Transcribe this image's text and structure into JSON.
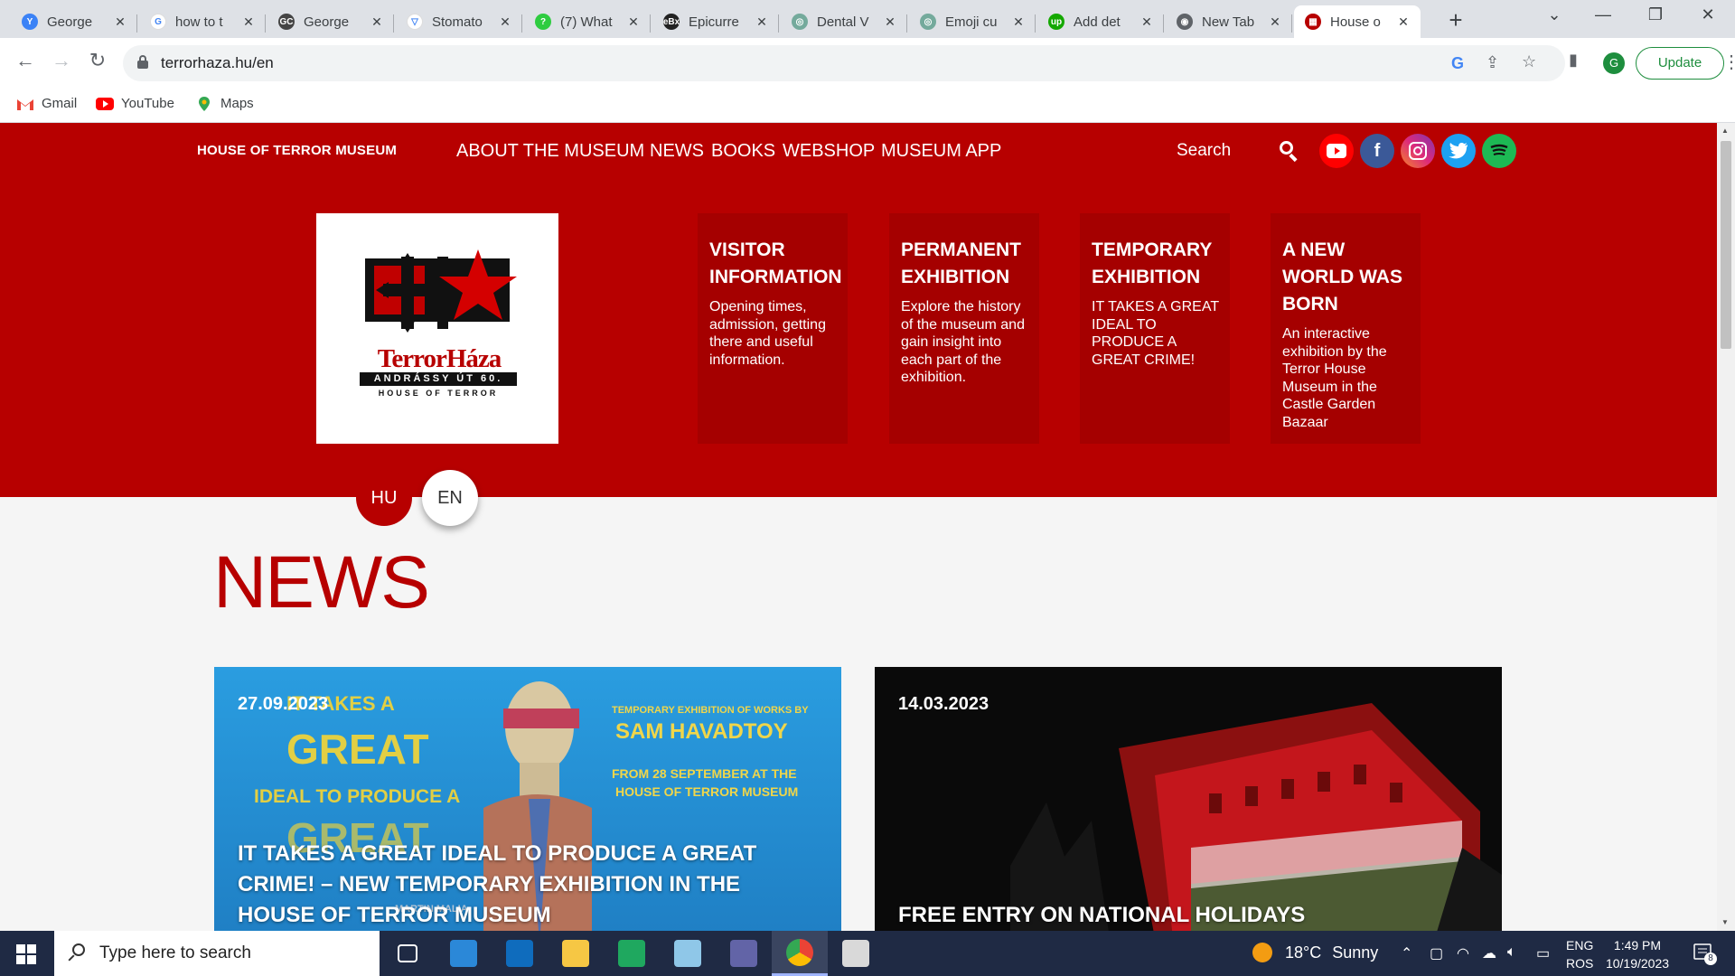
{
  "browser": {
    "tabs": [
      {
        "title": "George",
        "favicon_color": "#3b82f6",
        "favicon_glyph": "Y",
        "icon": "testing-icon"
      },
      {
        "title": "how to t",
        "favicon_color": "#ffffff",
        "favicon_glyph": "G",
        "icon": "google-icon"
      },
      {
        "title": "George",
        "favicon_color": "#444444",
        "favicon_glyph": "GC",
        "icon": "gc-icon"
      },
      {
        "title": "Stomato",
        "favicon_color": "#ffffff",
        "favicon_glyph": "▽",
        "icon": "vector-icon"
      },
      {
        "title": "(7) What",
        "favicon_color": "#2ecc40",
        "favicon_glyph": "?",
        "icon": "quora-icon"
      },
      {
        "title": "Epicurre",
        "favicon_color": "#222222",
        "favicon_glyph": "eBx",
        "icon": "ebx-icon"
      },
      {
        "title": "Dental V",
        "favicon_color": "#74aa9c",
        "favicon_glyph": "◎",
        "icon": "chatgpt-icon"
      },
      {
        "title": "Emoji cu",
        "favicon_color": "#74aa9c",
        "favicon_glyph": "◎",
        "icon": "chatgpt-icon"
      },
      {
        "title": "Add det",
        "favicon_color": "#14a800",
        "favicon_glyph": "up",
        "icon": "upwork-icon"
      },
      {
        "title": "New Tab",
        "favicon_color": "#5f6368",
        "favicon_glyph": "◉",
        "icon": "chrome-icon"
      },
      {
        "title": "House o",
        "favicon_color": "#b70000",
        "favicon_glyph": "▦",
        "icon": "terrorhaza-icon",
        "active": true
      }
    ],
    "url": "terrorhaza.hu/en",
    "profile_initial": "G",
    "update_label": "Update",
    "bookmarks": [
      {
        "label": "Gmail",
        "icon": "gmail-icon",
        "color": "#ea4335"
      },
      {
        "label": "YouTube",
        "icon": "youtube-icon",
        "color": "#ff0000"
      },
      {
        "label": "Maps",
        "icon": "maps-icon",
        "color": "#34a853"
      }
    ]
  },
  "site": {
    "brand": "HOUSE OF TERROR MUSEUM",
    "nav": [
      "ABOUT THE MUSEUM",
      "NEWS",
      "BOOKS",
      "WEBSHOP",
      "MUSEUM APP"
    ],
    "search_label": "Search",
    "social": [
      {
        "name": "youtube",
        "color": "#ff0000",
        "glyph": "▶"
      },
      {
        "name": "facebook",
        "color": "#3b5998",
        "glyph": "f"
      },
      {
        "name": "instagram",
        "color": "#c13584",
        "glyph": "◎"
      },
      {
        "name": "twitter",
        "color": "#1da1f2",
        "glyph": "✦"
      },
      {
        "name": "spotify",
        "color": "#1db954",
        "glyph": "≋"
      }
    ],
    "logo": {
      "title": "TerrorHáza",
      "address": "ANDRÁSSY ÚT 60.",
      "subtitle": "HOUSE OF TERROR"
    },
    "cards": [
      {
        "title": "VISITOR INFORMATION",
        "text": "Opening times, admission, getting there and useful information."
      },
      {
        "title": "PERMANENT EXHIBITION",
        "text": "Explore the history of the museum and gain insight into each part of the exhibition."
      },
      {
        "title": "TEMPORARY EXHIBITION",
        "text": "IT TAKES A GREAT IDEAL TO PRODUCE A GREAT CRIME!"
      },
      {
        "title": "A NEW WORLD WAS BORN",
        "text": "An interactive exhibition by the Terror House Museum in the Castle Garden Bazaar"
      }
    ],
    "languages": [
      "HU",
      "EN"
    ],
    "active_language": "EN",
    "news_heading": "NEWS",
    "news": [
      {
        "date": "27.09.2023",
        "title": "IT TAKES A GREAT IDEAL TO PRODUCE A GREAT CRIME! – NEW TEMPORARY EXHIBITION IN THE HOUSE OF TERROR MUSEUM",
        "poster": {
          "line1": "IT TAKES A",
          "line2": "GREAT",
          "line3": "IDEAL TO PRODUCE A",
          "line4": "GREAT",
          "right1": "TEMPORARY EXHIBITION OF WORKS BY",
          "right2": "SAM HAVADTOY",
          "right3": "FROM 28 SEPTEMBER AT THE",
          "right4": "HOUSE OF TERROR MUSEUM",
          "bottom": "MARTIN MALIA"
        }
      },
      {
        "date": "14.03.2023",
        "title": "FREE ENTRY ON NATIONAL HOLIDAYS"
      }
    ]
  },
  "taskbar": {
    "search_placeholder": "Type here to search",
    "apps": [
      {
        "name": "task-view-icon",
        "color": "#ffffff"
      },
      {
        "name": "microsoft-store-icon",
        "color": "#2b88d8"
      },
      {
        "name": "mail-icon",
        "color": "#0f6cbd"
      },
      {
        "name": "file-explorer-icon",
        "color": "#f6c744"
      },
      {
        "name": "edge-icon",
        "color": "#1fa85f"
      },
      {
        "name": "notepad-icon",
        "color": "#8fc7e8"
      },
      {
        "name": "teams-icon",
        "color": "#6264a7"
      },
      {
        "name": "chrome-icon",
        "color": "#ea4335"
      },
      {
        "name": "paint-icon",
        "color": "#d9d9d9"
      }
    ],
    "weather_temp": "18°C",
    "weather_text": "Sunny",
    "lang_line1": "ENG",
    "lang_line2": "ROS",
    "time": "1:49 PM",
    "date": "10/19/2023",
    "notification_count": "8"
  }
}
